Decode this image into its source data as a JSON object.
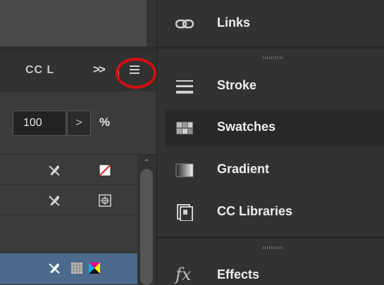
{
  "left_panel": {
    "tab_label": "CC L",
    "overflow_label": ">>",
    "menu_icon": "hamburger-menu-icon",
    "percent_value": "100",
    "percent_stepper": ">",
    "percent_unit": "%",
    "rows": [
      {
        "icons": [
          "pen-icon",
          "none-swatch-icon"
        ]
      },
      {
        "icons": [
          "pen-icon",
          "registration-icon"
        ]
      },
      {
        "icons": []
      },
      {
        "icons": [
          "pen-icon",
          "grid-icon",
          "process-color-icon"
        ],
        "selected": true
      }
    ],
    "highlight_color": "#d20f0f",
    "selection_color": "#4b6a8c"
  },
  "right_panel": {
    "items": [
      {
        "label": "Links",
        "icon": "link-icon"
      },
      {
        "label": "Stroke",
        "icon": "stroke-icon"
      },
      {
        "label": "Swatches",
        "icon": "swatches-icon",
        "active": true
      },
      {
        "label": "Gradient",
        "icon": "gradient-icon"
      },
      {
        "label": "CC Libraries",
        "icon": "cc-libraries-icon"
      },
      {
        "label": "Effects",
        "icon": "fx-icon",
        "glyph": "fx"
      }
    ]
  }
}
